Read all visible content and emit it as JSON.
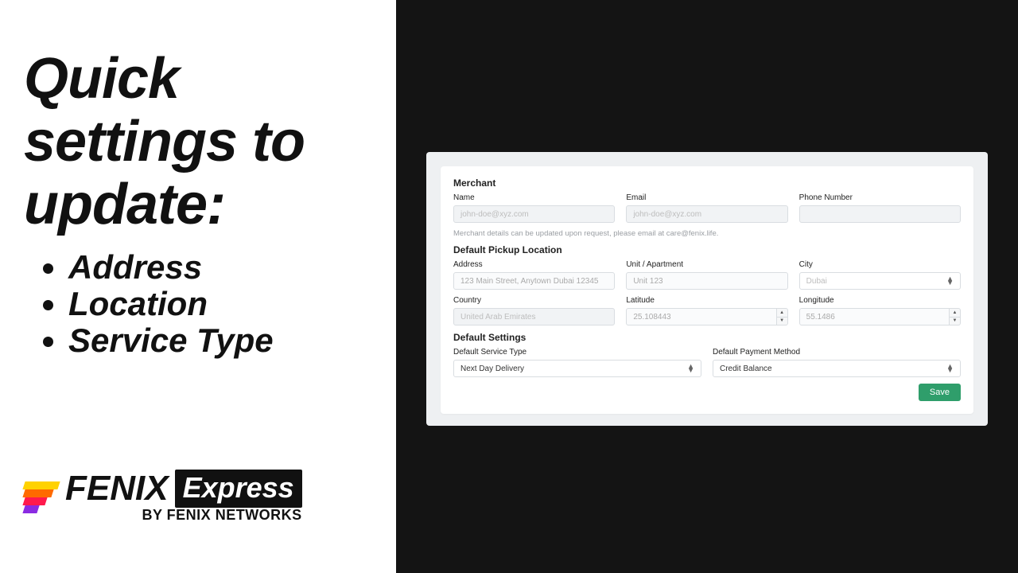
{
  "left": {
    "headline": "Quick settings to update:",
    "bullets": [
      "Address",
      "Location",
      "Service Type"
    ],
    "brand_main": "FENIX",
    "brand_badge": "Express",
    "brand_sub": "BY FENIX NETWORKS"
  },
  "form": {
    "sections": {
      "merchant": "Merchant",
      "pickup": "Default Pickup Location",
      "defaults": "Default Settings"
    },
    "merchant": {
      "name_label": "Name",
      "name_value": "john-doe@xyz.com",
      "email_label": "Email",
      "email_value": "john-doe@xyz.com",
      "phone_label": "Phone Number",
      "phone_value": "",
      "helper": "Merchant details can be updated upon request, please email at care@fenix.life."
    },
    "pickup": {
      "address_label": "Address",
      "address_placeholder": "123 Main Street, Anytown Dubai 12345",
      "unit_label": "Unit / Apartment",
      "unit_placeholder": "Unit 123",
      "city_label": "City",
      "city_value": "Dubai",
      "country_label": "Country",
      "country_value": "United Arab Emirates",
      "lat_label": "Latitude",
      "lat_value": "25.108443",
      "lng_label": "Longitude",
      "lng_value": "55.1486"
    },
    "defaults": {
      "service_label": "Default Service Type",
      "service_value": "Next Day Delivery",
      "payment_label": "Default Payment Method",
      "payment_value": "Credit Balance"
    },
    "save_label": "Save"
  }
}
